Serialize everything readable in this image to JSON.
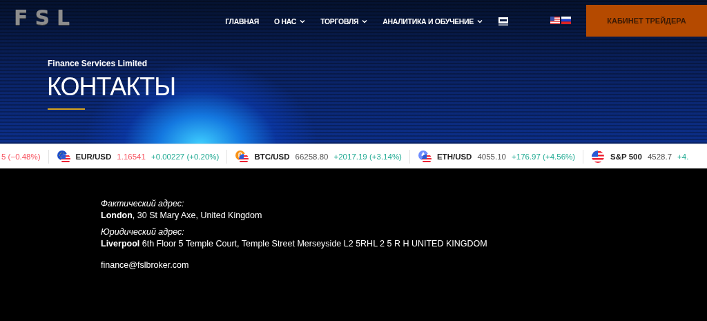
{
  "header": {
    "logo": "FSL",
    "nav": [
      {
        "label": "ГЛАВНАЯ",
        "has_dropdown": false
      },
      {
        "label": "О НАС",
        "has_dropdown": true
      },
      {
        "label": "ТОРГОВЛЯ",
        "has_dropdown": true
      },
      {
        "label": "АНАЛИТИКА И ОБУЧЕНИЕ",
        "has_dropdown": true
      }
    ],
    "cta_button": "КАБИНЕТ ТРЕЙДЕРА"
  },
  "hero": {
    "subtitle": "Finance Services Limited",
    "title": "КОНТАКТЫ"
  },
  "ticker": [
    {
      "kind": "partial",
      "change": {
        "text": "5 (−0.48%)",
        "color": "#f7525f"
      }
    },
    {
      "kind": "euro",
      "symbol": "EUR/USD",
      "price": {
        "text": "1.16541",
        "color": "#f7525f"
      },
      "change": {
        "text": "+0.00227 (+0.20%)",
        "color": "#22ab94"
      }
    },
    {
      "kind": "bitcoin",
      "symbol": "BTC/USD",
      "price": {
        "text": "66258.80",
        "color": "#555555"
      },
      "change": {
        "text": "+2017.19 (+3.14%)",
        "color": "#22ab94"
      }
    },
    {
      "kind": "ether",
      "symbol": "ETH/USD",
      "price": {
        "text": "4055.10",
        "color": "#555555"
      },
      "change": {
        "text": "+176.97 (+4.56%)",
        "color": "#22ab94"
      }
    },
    {
      "kind": "index",
      "symbol": "S&P 500",
      "price": {
        "text": "4528.7",
        "color": "#555555"
      },
      "change": {
        "text": "+4.",
        "color": "#22ab94"
      }
    }
  ],
  "contacts": [
    {
      "kind": "label",
      "text": "Фактический адрес:"
    },
    {
      "kind": "address",
      "text": "**London**, 30 St Mary Axe, United Kingdom"
    },
    {
      "kind": "label",
      "text": "Юридический адрес:"
    },
    {
      "kind": "address",
      "text": "**Liverpool** 6th Floor 5 Temple Court, Temple Street Merseyside L2 5RHL 2 5 R H UNITED KINGDOM"
    },
    {
      "kind": "email",
      "text": "finance@fslbroker.com"
    }
  ]
}
